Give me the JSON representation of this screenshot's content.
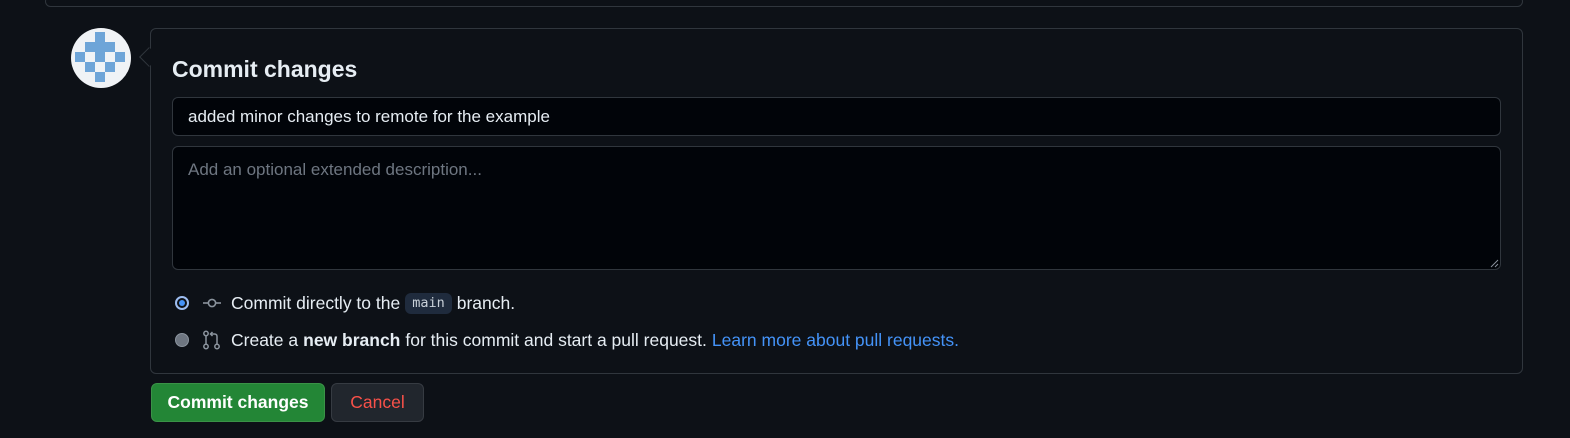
{
  "commit_form": {
    "title": "Commit changes",
    "summary_value": "added minor changes to remote for the example",
    "description_placeholder": "Add an optional extended description...",
    "description_value": "",
    "options": {
      "direct": {
        "selected": true,
        "icon": "git-commit-icon",
        "prefix": "Commit directly to the",
        "branch": "main",
        "suffix": "branch."
      },
      "new_branch": {
        "selected": false,
        "icon": "git-pull-request-icon",
        "prefix": "Create a",
        "bold": "new branch",
        "suffix": "for this commit and start a pull request.",
        "link": "Learn more about pull requests."
      }
    },
    "buttons": {
      "commit": "Commit changes",
      "cancel": "Cancel"
    }
  },
  "colors": {
    "background": "#0d1117",
    "border": "#30363d",
    "input_bg": "#010409",
    "primary_button": "#238636",
    "danger_text": "#f85149",
    "link": "#4493f8",
    "avatar_pattern": "#6ea5d8"
  }
}
